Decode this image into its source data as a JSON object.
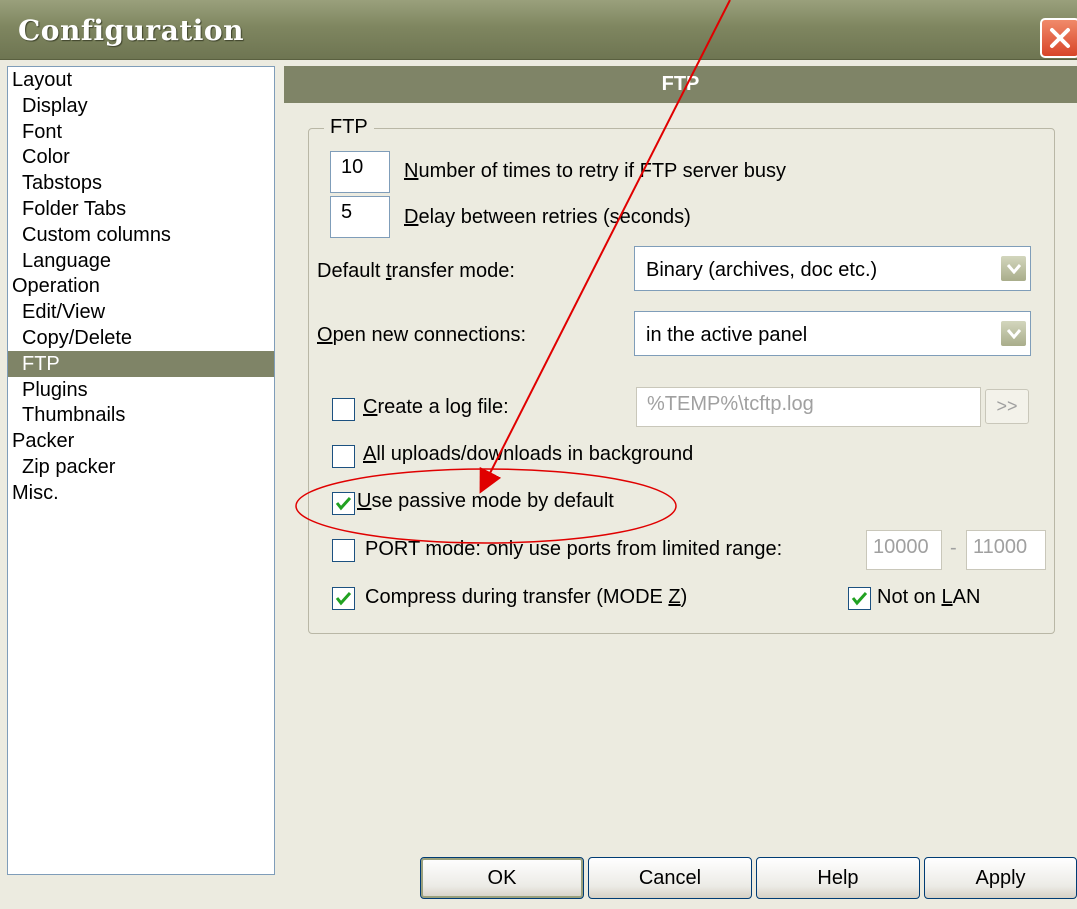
{
  "window": {
    "title": "Configuration"
  },
  "tree": {
    "items": [
      {
        "label": "Layout",
        "level": 0
      },
      {
        "label": "Display",
        "level": 1
      },
      {
        "label": "Font",
        "level": 1
      },
      {
        "label": "Color",
        "level": 1
      },
      {
        "label": "Tabstops",
        "level": 1
      },
      {
        "label": "Folder Tabs",
        "level": 1
      },
      {
        "label": "Custom columns",
        "level": 1
      },
      {
        "label": "Language",
        "level": 1
      },
      {
        "label": "Operation",
        "level": 0
      },
      {
        "label": "Edit/View",
        "level": 1
      },
      {
        "label": "Copy/Delete",
        "level": 1
      },
      {
        "label": "FTP",
        "level": 1,
        "selected": true
      },
      {
        "label": "Plugins",
        "level": 1
      },
      {
        "label": "Thumbnails",
        "level": 1
      },
      {
        "label": "Packer",
        "level": 0
      },
      {
        "label": "Zip packer",
        "level": 1
      },
      {
        "label": "Misc.",
        "level": 0
      }
    ]
  },
  "panel": {
    "header": "FTP",
    "group_label": "FTP",
    "retry": {
      "value": "10",
      "label_u": "N",
      "label_rest": "umber of times to retry if FTP server busy"
    },
    "delay": {
      "value": "5",
      "label_u": "D",
      "label_rest": "elay between retries (seconds)"
    },
    "transfer_mode": {
      "label_pre": "Default ",
      "label_u": "t",
      "label_rest": "ransfer mode:",
      "value": "Binary (archives, doc etc.)"
    },
    "open_conn": {
      "label_u": "O",
      "label_rest": "pen new connections:",
      "value": "in the active panel"
    },
    "log_file": {
      "label_u": "C",
      "label_rest": "reate a log file:",
      "path": "%TEMP%\\tcftp.log",
      "browse": ">>",
      "checked": false
    },
    "background": {
      "label_u": "A",
      "label_rest": "ll uploads/downloads in background",
      "checked": false
    },
    "passive": {
      "label_u": "U",
      "label_rest": "se passive mode by default",
      "checked": true
    },
    "port_mode": {
      "label": "PORT mode: only use ports from limited range:",
      "from": "10000",
      "sep": "-",
      "to": "11000",
      "checked": false
    },
    "compress": {
      "label_pre": "Compress during transfer (MODE ",
      "label_u": "Z",
      "label_post": ")",
      "checked": true
    },
    "not_lan": {
      "label_pre": "Not on ",
      "label_u": "L",
      "label_rest": "AN",
      "checked": true
    }
  },
  "buttons": {
    "ok": "OK",
    "cancel": "Cancel",
    "help": "Help",
    "apply": "Apply"
  },
  "colors": {
    "annotation": "#e00000",
    "check": "#21a121",
    "selection": "#7f8467"
  }
}
